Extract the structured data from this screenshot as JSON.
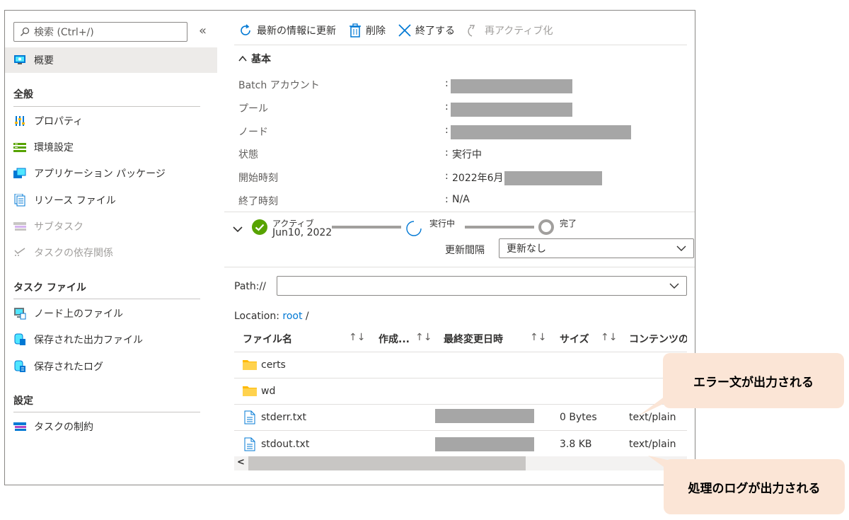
{
  "sidebar": {
    "search_placeholder": "検索 (Ctrl+/)",
    "collapse_label": "«",
    "overview": "概要",
    "sections": {
      "general": "全般",
      "task_files": "タスク ファイル",
      "settings": "設定"
    },
    "items": {
      "properties": "プロパティ",
      "env_settings": "環境設定",
      "app_packages": "アプリケーション パッケージ",
      "resource_files": "リソース ファイル",
      "subtasks": "サブタスク",
      "task_dependencies": "タスクの依存関係",
      "files_on_node": "ノード上のファイル",
      "saved_output_files": "保存された出力ファイル",
      "saved_logs": "保存されたログ",
      "task_constraints": "タスクの制約"
    }
  },
  "toolbar": {
    "refresh": "最新の情報に更新",
    "delete": "削除",
    "terminate": "終了する",
    "reactivate": "再アクティブ化"
  },
  "basics": {
    "title": "基本",
    "rows": [
      {
        "label": "Batch アカウント",
        "value": ""
      },
      {
        "label": "プール",
        "value": ""
      },
      {
        "label": "ノード",
        "value": ""
      },
      {
        "label": "状態",
        "value": "実行中"
      },
      {
        "label": "開始時刻",
        "value": "2022年6月"
      },
      {
        "label": "終了時刻",
        "value": "N/A"
      }
    ],
    "colon": ":"
  },
  "progress": {
    "steps": [
      {
        "label": "アクティブ",
        "date": "Jun10, 2022",
        "state": "done"
      },
      {
        "label": "実行中",
        "state": "running"
      },
      {
        "label": "完了",
        "state": "pending"
      }
    ],
    "refresh_interval_label": "更新間隔",
    "refresh_interval_value": "更新なし"
  },
  "files": {
    "path_label": "Path://",
    "path_value": "",
    "location_prefix": "Location:",
    "location_link": "root",
    "location_suffix": "/",
    "columns": {
      "name": "ファイル名",
      "created": "作成...",
      "modified": "最終変更日時",
      "size": "サイズ",
      "content_type": "コンテンツの種"
    },
    "sort_icon": "↑↓",
    "rows": [
      {
        "type": "folder",
        "name": "certs",
        "size": "",
        "content_type": ""
      },
      {
        "type": "folder",
        "name": "wd",
        "size": "",
        "content_type": ""
      },
      {
        "type": "file",
        "name": "stderr.txt",
        "size": "0 Bytes",
        "content_type": "text/plain"
      },
      {
        "type": "file",
        "name": "stdout.txt",
        "size": "3.8 KB",
        "content_type": "text/plain"
      }
    ],
    "scroll_left": "<"
  },
  "callouts": {
    "stderr": "エラー文が出力される",
    "stdout": "処理のログが出力される"
  },
  "colors": {
    "accent": "#0078d4",
    "success": "#57a300",
    "callout_bg": "#fbe5d6",
    "redaction": "#a6a6a6"
  }
}
